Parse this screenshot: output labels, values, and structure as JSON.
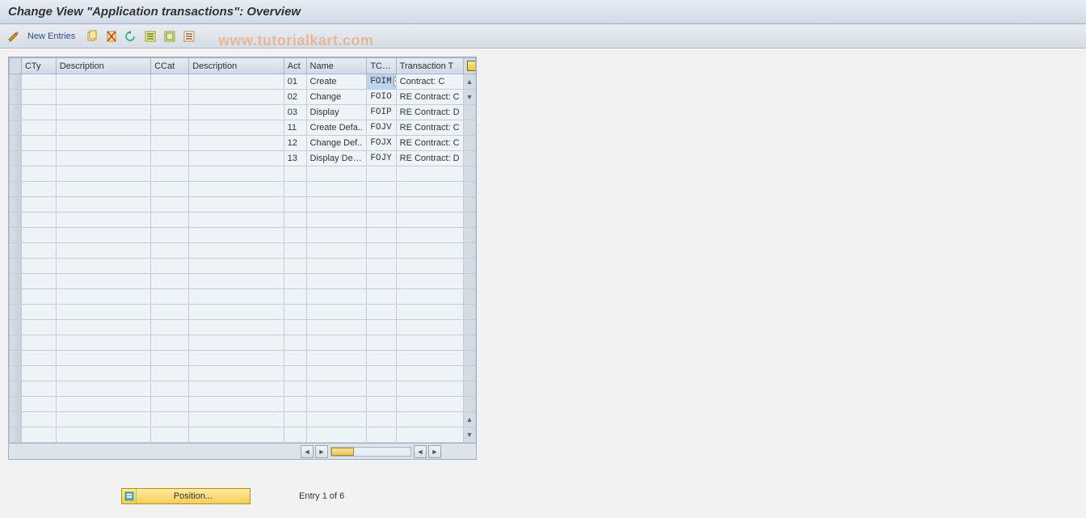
{
  "title": "Change View \"Application transactions\": Overview",
  "toolbar": {
    "new_entries": "New Entries"
  },
  "watermark": "www.tutorialkart.com",
  "columns": {
    "cty": "CTy",
    "desc1": "Description",
    "ccat": "CCat",
    "desc2": "Description",
    "act": "Act",
    "name": "Name",
    "tcode": "TCo...",
    "txtext": "Transaction T"
  },
  "rows": [
    {
      "act": "01",
      "name": "Create",
      "tcode": "FOIM",
      "txtext": "Contract: C",
      "selected": true
    },
    {
      "act": "02",
      "name": "Change",
      "tcode": "FOIO",
      "txtext": "RE Contract: C",
      "selected": false
    },
    {
      "act": "03",
      "name": "Display",
      "tcode": "FOIP",
      "txtext": "RE Contract: D",
      "selected": false
    },
    {
      "act": "11",
      "name": "Create Defa..",
      "tcode": "FOJV",
      "txtext": "RE Contract: C",
      "selected": false
    },
    {
      "act": "12",
      "name": "Change Def..",
      "tcode": "FOJX",
      "txtext": "RE Contract: C",
      "selected": false
    },
    {
      "act": "13",
      "name": "Display Defa..",
      "tcode": "FOJY",
      "txtext": "RE Contract: D",
      "selected": false
    }
  ],
  "empty_row_count": 18,
  "footer": {
    "position_label": "Position...",
    "entry_status": "Entry 1 of 6"
  }
}
